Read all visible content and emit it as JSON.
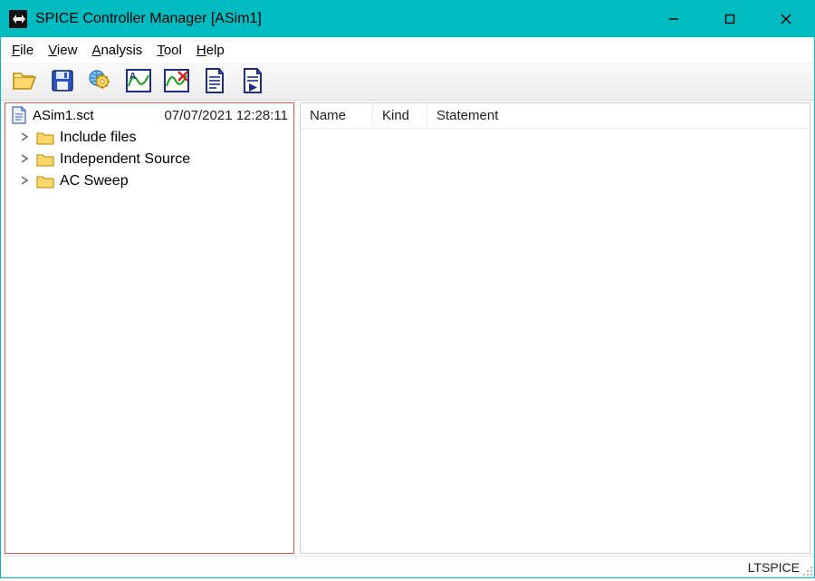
{
  "window": {
    "title": "SPICE Controller Manager [ASim1]"
  },
  "menubar": {
    "items": [
      {
        "label": "File",
        "accel_index": 0
      },
      {
        "label": "View",
        "accel_index": 0
      },
      {
        "label": "Analysis",
        "accel_index": 0
      },
      {
        "label": "Tool",
        "accel_index": 0
      },
      {
        "label": "Help",
        "accel_index": 0
      }
    ]
  },
  "toolbar": {
    "buttons": [
      {
        "id": "open",
        "icon": "folder-open-icon"
      },
      {
        "id": "save",
        "icon": "floppy-icon"
      },
      {
        "id": "gear",
        "icon": "gear-globe-icon"
      },
      {
        "id": "plot-a",
        "icon": "waveform-a-icon"
      },
      {
        "id": "plot-x",
        "icon": "waveform-x-icon"
      },
      {
        "id": "doc",
        "icon": "document-lines-icon"
      },
      {
        "id": "docrun",
        "icon": "document-play-icon"
      }
    ]
  },
  "tree": {
    "root": {
      "filename": "ASim1.sct",
      "timestamp": "07/07/2021 12:28:11"
    },
    "items": [
      {
        "id": "include",
        "label": "Include files"
      },
      {
        "id": "indep",
        "label": "Independent Source"
      },
      {
        "id": "acsweep",
        "label": "AC Sweep"
      }
    ]
  },
  "detail": {
    "columns": [
      {
        "id": "name",
        "label": "Name"
      },
      {
        "id": "kind",
        "label": "Kind"
      },
      {
        "id": "statement",
        "label": "Statement"
      }
    ]
  },
  "statusbar": {
    "text": "LTSPICE"
  }
}
